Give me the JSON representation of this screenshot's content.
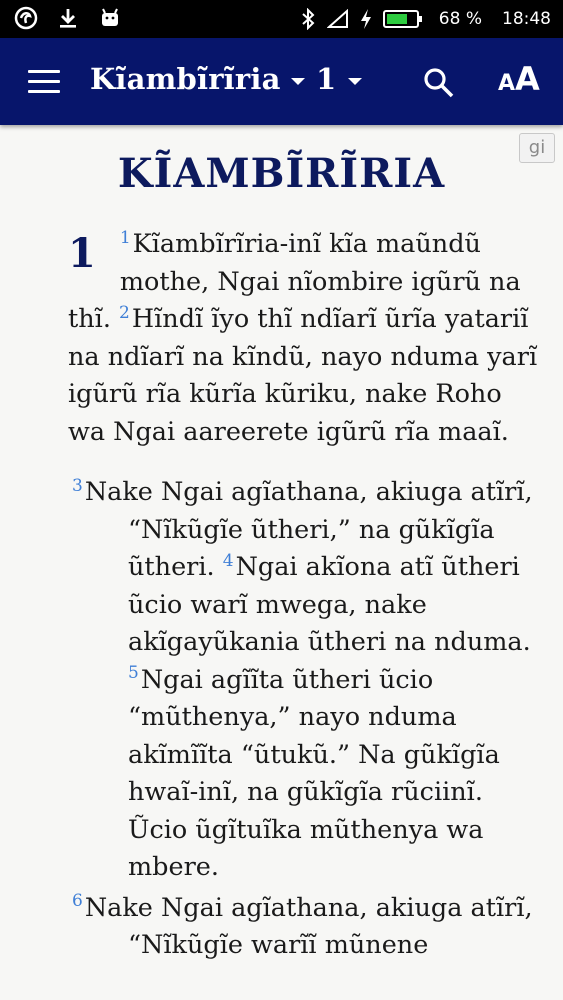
{
  "status_bar": {
    "battery": "68 %",
    "time": "18:48"
  },
  "app_bar": {
    "book": "Kĩambĩrĩria",
    "chapter": "1",
    "search_icon": "search-icon",
    "text_size_icon": "text-size-icon"
  },
  "content": {
    "language_badge": "gi",
    "book_title": "KĨAMBĨRĨRIA",
    "chapter_number": "1",
    "paragraph1": {
      "v1_num": "1",
      "v1_text": "Kĩambĩrĩria-inĩ kĩa maũndũ mothe, Ngai nĩombire igũrũ na thĩ.",
      "v2_num": "2",
      "v2_text": "Hĩndĩ ĩyo thĩ ndĩarĩ ũrĩa yatariĩ na ndĩarĩ na kĩndũ, nayo nduma yarĩ igũrũ rĩa kũrĩa kũriku, nake Roho wa Ngai aareerete igũrũ rĩa maaĩ."
    },
    "paragraph2": {
      "v3_num": "3",
      "v3_text": "Nake Ngai agĩathana, akiuga atĩrĩ, “Nĩkũgĩe ũtheri,” na gũkĩgĩa ũtheri.",
      "v4_num": "4",
      "v4_text": "Ngai akĩona atĩ ũtheri ũcio warĩ mwega, nake akĩgayũkania ũtheri na nduma.",
      "v5_num": "5",
      "v5_text": "Ngai agĩĩta ũtheri ũcio “mũthenya,” nayo nduma akĩmĩĩta “ũtukũ.” Na gũkĩgĩa hwaĩ-inĩ, na gũkĩgĩa rũciinĩ. Ũcio ũgĩtuĩka mũthenya wa mbere."
    },
    "paragraph3": {
      "v6_num": "6",
      "v6_text": "Nake Ngai agĩathana, akiuga atĩrĩ, “Nĩkũgĩe warĩĩ mũnene"
    }
  },
  "colors": {
    "app_bar": "#07156b",
    "title": "#0d1a5e",
    "verse_number": "#3f7fd6",
    "background": "#f7f7f5"
  }
}
